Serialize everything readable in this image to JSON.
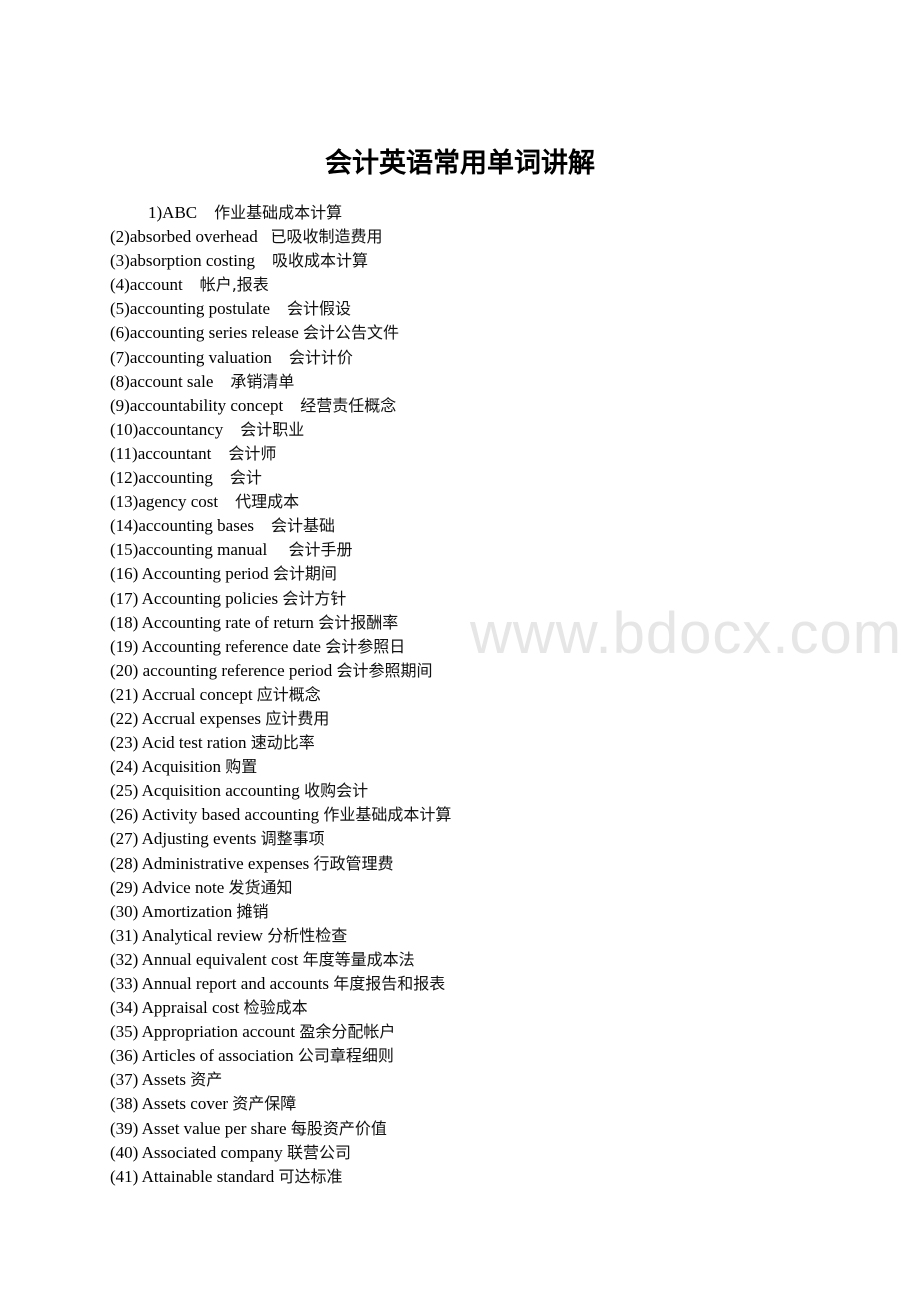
{
  "document": {
    "title": "会计英语常用单词讲解",
    "watermark": "www.bdocx.com",
    "entries": [
      {
        "en": "1)ABC    ",
        "zh": "作业基础成本计算"
      },
      {
        "en": "(2)absorbed overhead   ",
        "zh": "已吸收制造费用"
      },
      {
        "en": "(3)absorption costing    ",
        "zh": "吸收成本计算"
      },
      {
        "en": "(4)account    ",
        "zh": "帐户,报表"
      },
      {
        "en": "(5)accounting postulate    ",
        "zh": "会计假设"
      },
      {
        "en": "(6)accounting series release ",
        "zh": "会计公告文件"
      },
      {
        "en": "(7)accounting valuation    ",
        "zh": "会计计价"
      },
      {
        "en": "(8)account sale    ",
        "zh": "承销清单"
      },
      {
        "en": "(9)accountability concept    ",
        "zh": "经营责任概念"
      },
      {
        "en": "(10)accountancy    ",
        "zh": "会计职业"
      },
      {
        "en": "(11)accountant    ",
        "zh": "会计师"
      },
      {
        "en": "(12)accounting    ",
        "zh": "会计"
      },
      {
        "en": "(13)agency cost    ",
        "zh": "代理成本"
      },
      {
        "en": "(14)accounting bases    ",
        "zh": "会计基础"
      },
      {
        "en": "(15)accounting manual     ",
        "zh": "会计手册"
      },
      {
        "en": "(16) Accounting period ",
        "zh": "会计期间"
      },
      {
        "en": "(17) Accounting policies ",
        "zh": "会计方针"
      },
      {
        "en": "(18) Accounting rate of return ",
        "zh": "会计报酬率"
      },
      {
        "en": "(19) Accounting reference date ",
        "zh": "会计参照日"
      },
      {
        "en": "(20) accounting reference period ",
        "zh": "会计参照期间"
      },
      {
        "en": "(21) Accrual concept ",
        "zh": "应计概念"
      },
      {
        "en": "(22) Accrual expenses ",
        "zh": "应计费用"
      },
      {
        "en": "(23) Acid test ration ",
        "zh": "速动比率"
      },
      {
        "en": "(24) Acquisition ",
        "zh": "购置"
      },
      {
        "en": "(25) Acquisition accounting ",
        "zh": "收购会计"
      },
      {
        "en": "(26) Activity based accounting ",
        "zh": "作业基础成本计算"
      },
      {
        "en": "(27) Adjusting events ",
        "zh": "调整事项"
      },
      {
        "en": "(28) Administrative expenses ",
        "zh": "行政管理费"
      },
      {
        "en": "(29) Advice note ",
        "zh": "发货通知"
      },
      {
        "en": "(30) Amortization ",
        "zh": "摊销"
      },
      {
        "en": "(31) Analytical review ",
        "zh": "分析性检查"
      },
      {
        "en": "(32) Annual equivalent cost ",
        "zh": "年度等量成本法"
      },
      {
        "en": "(33) Annual report and accounts ",
        "zh": "年度报告和报表"
      },
      {
        "en": "(34) Appraisal cost ",
        "zh": "检验成本"
      },
      {
        "en": "(35) Appropriation account ",
        "zh": "盈余分配帐户"
      },
      {
        "en": "(36) Articles of association ",
        "zh": "公司章程细则"
      },
      {
        "en": "(37) Assets ",
        "zh": "资产"
      },
      {
        "en": "(38) Assets cover ",
        "zh": "资产保障"
      },
      {
        "en": "(39) Asset value per share ",
        "zh": "每股资产价值"
      },
      {
        "en": "(40) Associated company ",
        "zh": "联营公司"
      },
      {
        "en": "(41) Attainable standard ",
        "zh": "可达标准"
      }
    ]
  }
}
